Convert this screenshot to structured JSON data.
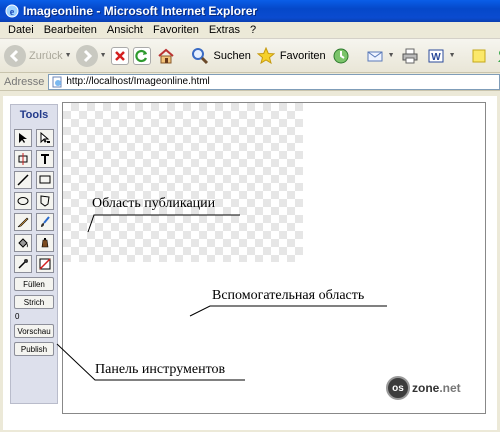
{
  "window": {
    "title": "Imageonline - Microsoft Internet Explorer"
  },
  "menu": [
    "Datei",
    "Bearbeiten",
    "Ansicht",
    "Favoriten",
    "Extras",
    "?"
  ],
  "toolbar": {
    "back_label": "Zurück",
    "search_label": "Suchen",
    "favorites_label": "Favoriten"
  },
  "address": {
    "label": "Adresse",
    "url": "http://localhost/Imageonline.html"
  },
  "tools_panel": {
    "title": "Tools",
    "tools": [
      "select-arrow-icon",
      "subselect-arrow-icon",
      "transform-icon",
      "text-icon",
      "line-icon",
      "rectangle-icon",
      "ellipse-icon",
      "polygon-icon",
      "pencil-icon",
      "brush-icon",
      "paint-bucket-icon",
      "ink-bottle-icon",
      "eyedropper-icon",
      "no-color-icon"
    ],
    "fill_button": "Füllen",
    "stroke_button": "Strich",
    "counter": "0",
    "preview_button": "Vorschau",
    "publish_button": "Publish"
  },
  "annotations": {
    "publish_area": "Область публикации",
    "aux_area": "Вспомогательная область",
    "toolbar_panel": "Панель инструментов"
  },
  "logo": {
    "prefix": "os",
    "name": "zone",
    "suffix": ".net"
  },
  "colors": {
    "titlebar": "#0548c9",
    "canvas_check": "#e6e6e6",
    "panel": "#dde0ec"
  }
}
